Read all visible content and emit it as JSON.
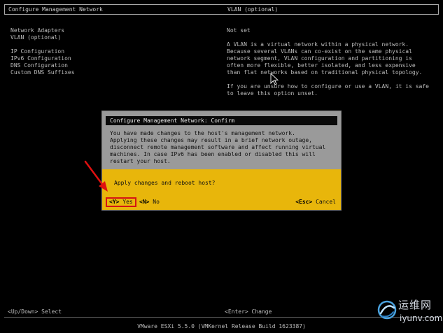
{
  "header": {
    "left_title": "Configure Management Network",
    "right_title": "VLAN (optional)"
  },
  "menu": {
    "items": [
      "Network Adapters",
      "VLAN (optional)",
      "",
      "IP Configuration",
      "IPv6 Configuration",
      "DNS Configuration",
      "Custom DNS Suffixes"
    ]
  },
  "description": {
    "status": "Not set",
    "lines": [
      "A VLAN is a virtual network within a physical network.",
      "Because several VLANs can co-exist on the same physical",
      "network segment, VLAN configuration and partitioning is",
      "often more flexible, better isolated, and less expensive",
      "than flat networks based on traditional physical topology.",
      "",
      "If you are unsure how to configure or use a VLAN, it is safe",
      "to leave this option unset."
    ]
  },
  "dialog": {
    "title": "Configure Management Network: Confirm",
    "body_lines": [
      "You have made changes to the host's management network.",
      "Applying these changes may result in a brief network outage,",
      "disconnect remote management software and affect running virtual",
      "machines. In case IPv6 has been enabled or disabled this will",
      "restart your host."
    ],
    "question": "Apply changes and reboot host?",
    "yes": {
      "key": "<Y>",
      "label": " Yes"
    },
    "no": {
      "key": "<N>",
      "label": " No"
    },
    "cancel": {
      "key": "<Esc>",
      "label": " Cancel"
    }
  },
  "hints": {
    "left": "<Up/Down> Select",
    "right": "<Enter> Change"
  },
  "footer": "VMware ESXi 5.5.0 (VMKernel Release Build 1623387)",
  "watermark": {
    "cn": "运维网",
    "en": "iyunv.com"
  },
  "colors": {
    "dialog_gray": "#9a9a9a",
    "dialog_yellow": "#e8b60b",
    "highlight_red": "#d41414"
  }
}
